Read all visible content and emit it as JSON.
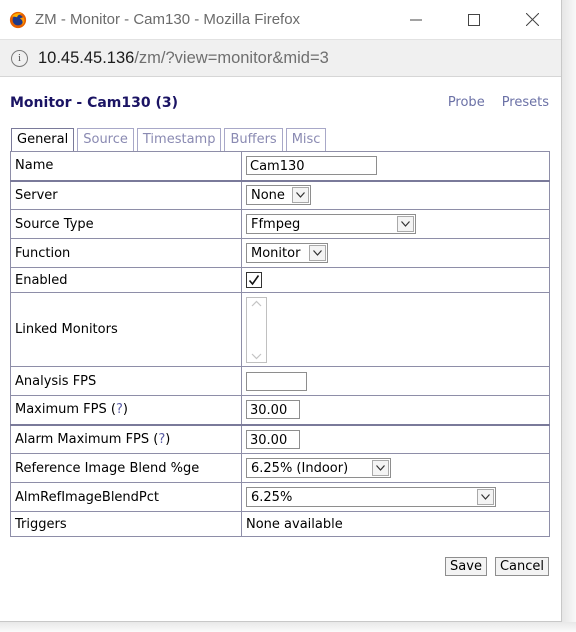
{
  "window": {
    "title": "ZM - Monitor - Cam130 - Mozilla Firefox"
  },
  "urlbar": {
    "host": "10.45.45.136",
    "path": "/zm/?view=monitor&mid=3"
  },
  "page": {
    "title": "Monitor - Cam130 (3)",
    "links": {
      "probe": "Probe",
      "presets": "Presets"
    }
  },
  "tabs": [
    "General",
    "Source",
    "Timestamp",
    "Buffers",
    "Misc"
  ],
  "active_tab": "General",
  "rows": {
    "name": {
      "label": "Name",
      "value": "Cam130"
    },
    "server": {
      "label": "Server",
      "value": "None"
    },
    "source_type": {
      "label": "Source Type",
      "value": "Ffmpeg"
    },
    "function": {
      "label": "Function",
      "value": "Monitor"
    },
    "enabled": {
      "label": "Enabled",
      "checked": true
    },
    "linked_monitors": {
      "label": "Linked Monitors"
    },
    "analysis_fps": {
      "label": "Analysis FPS",
      "value": ""
    },
    "maximum_fps": {
      "label": "Maximum FPS",
      "help": "?",
      "value": "30.00"
    },
    "alarm_maximum_fps": {
      "label": "Alarm Maximum FPS",
      "help": "?",
      "value": "30.00"
    },
    "ref_blend": {
      "label": "Reference Image Blend %ge",
      "value": "6.25% (Indoor)"
    },
    "alm_ref_blend": {
      "label": "AlmRefImageBlendPct",
      "value": "6.25%"
    },
    "triggers": {
      "label": "Triggers",
      "value": "None available"
    }
  },
  "buttons": {
    "save": "Save",
    "cancel": "Cancel"
  },
  "colors": {
    "header_text": "#1b1464",
    "link": "#6b71a6",
    "tab_inactive": "#8a8ab2",
    "table_border": "#8e8ea8"
  }
}
